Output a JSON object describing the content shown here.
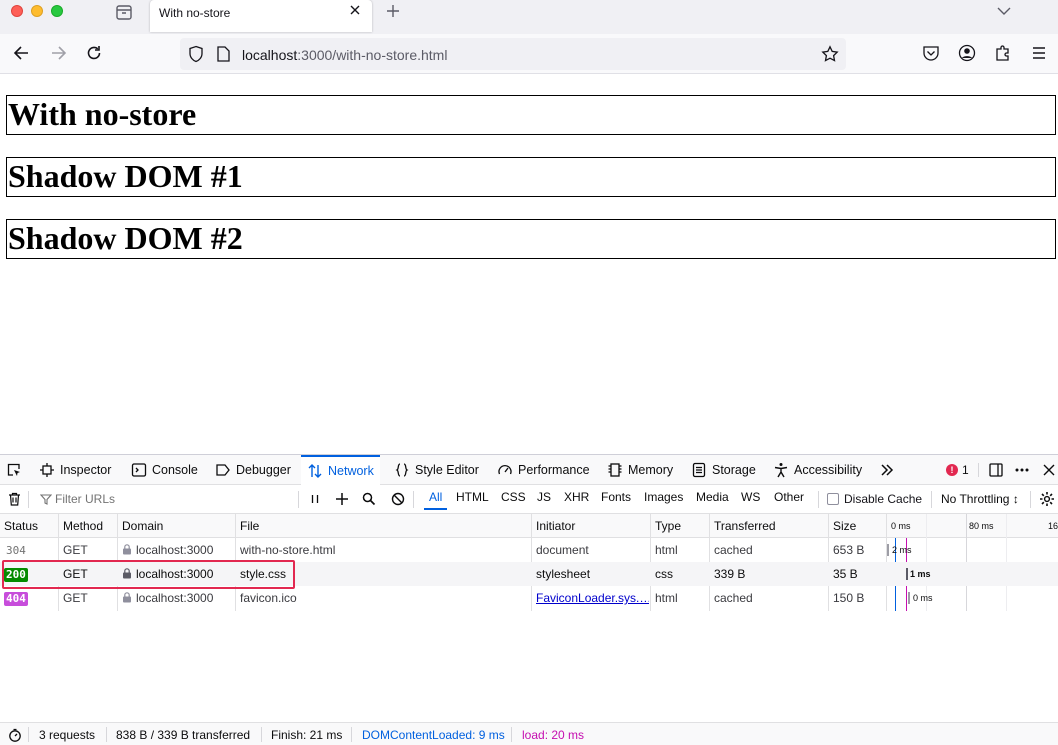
{
  "browser": {
    "tab_title": "With no-store",
    "url_host": "localhost",
    "url_path": ":3000/with-no-store.html"
  },
  "page": {
    "heading_main": "With no-store",
    "shadow_1": "Shadow DOM #1",
    "shadow_2": "Shadow DOM #2"
  },
  "devtools": {
    "tabs": [
      {
        "label": "Inspector",
        "icon": "inspector-icon"
      },
      {
        "label": "Console",
        "icon": "console-icon"
      },
      {
        "label": "Debugger",
        "icon": "debugger-icon"
      },
      {
        "label": "Network",
        "icon": "network-icon"
      },
      {
        "label": "Style Editor",
        "icon": "style-editor-icon"
      },
      {
        "label": "Performance",
        "icon": "performance-icon"
      },
      {
        "label": "Memory",
        "icon": "memory-icon"
      },
      {
        "label": "Storage",
        "icon": "storage-icon"
      },
      {
        "label": "Accessibility",
        "icon": "accessibility-icon"
      }
    ],
    "error_count": "1",
    "network": {
      "filter_placeholder": "Filter URLs",
      "type_filters": [
        "All",
        "HTML",
        "CSS",
        "JS",
        "XHR",
        "Fonts",
        "Images",
        "Media",
        "WS",
        "Other"
      ],
      "disable_cache_label": "Disable Cache",
      "throttling": "No Throttling ↕",
      "columns": [
        "Status",
        "Method",
        "Domain",
        "File",
        "Initiator",
        "Type",
        "Transferred",
        "Size"
      ],
      "waterfall_ticks": [
        "0 ms",
        "80 ms",
        "16"
      ],
      "rows": [
        {
          "status": "304",
          "method": "GET",
          "domain": "localhost:3000",
          "file": "with-no-store.html",
          "initiator": "document",
          "type": "html",
          "transferred": "cached",
          "size": "653 B",
          "timing": "2 ms"
        },
        {
          "status": "200",
          "method": "GET",
          "domain": "localhost:3000",
          "file": "style.css",
          "initiator": "stylesheet",
          "type": "css",
          "transferred": "339 B",
          "size": "35 B",
          "timing": "1 ms"
        },
        {
          "status": "404",
          "method": "GET",
          "domain": "localhost:3000",
          "file": "favicon.ico",
          "initiator": "FaviconLoader.sys.…",
          "type": "html",
          "transferred": "cached",
          "size": "150 B",
          "timing": "0 ms"
        }
      ]
    },
    "status_bar": {
      "requests": "3 requests",
      "transferred": "838 B / 339 B transferred",
      "finish": "Finish: 21 ms",
      "dom_content_loaded": "DOMContentLoaded: 9 ms",
      "load": "load: 20 ms"
    }
  },
  "colors": {
    "accent": "#0060df",
    "status_200": "#058b00",
    "status_404": "#c74ddb",
    "highlight": "#e22850",
    "dcl": "#0060df",
    "load": "#c50fb0"
  }
}
